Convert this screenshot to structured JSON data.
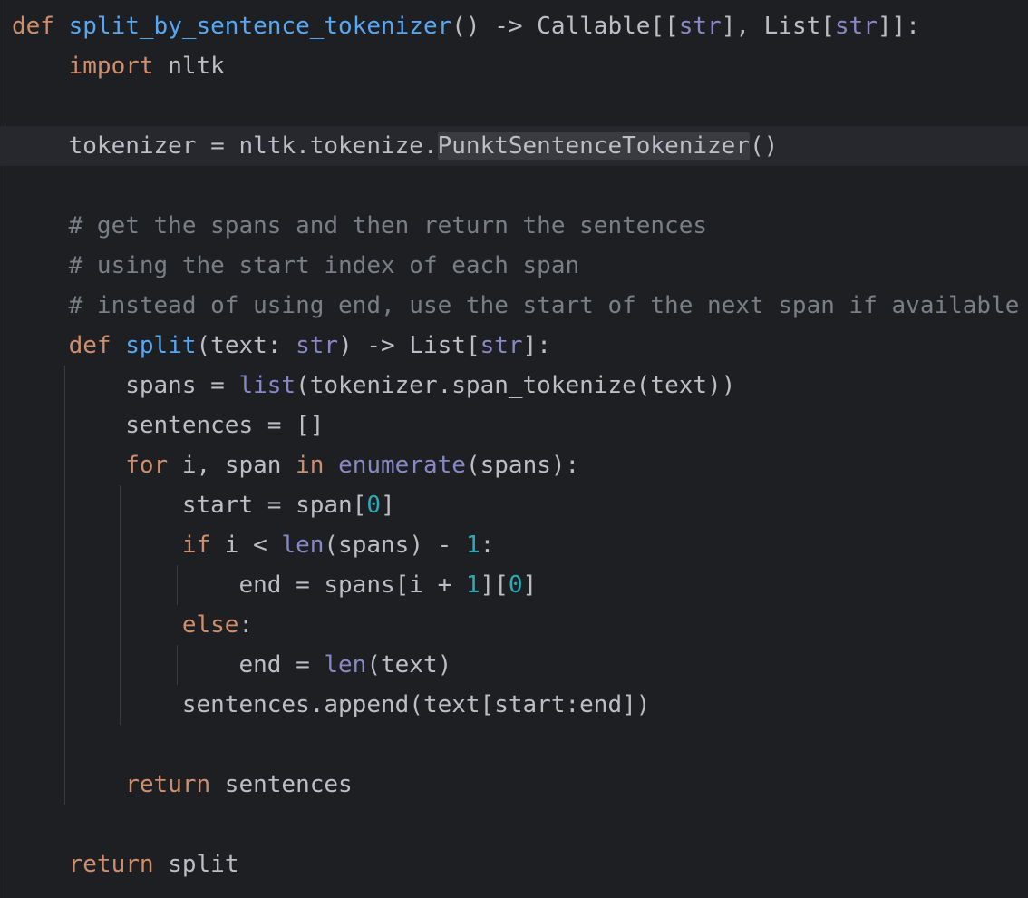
{
  "editor": {
    "language": "python",
    "colors": {
      "background": "#1e1f22",
      "current_line": "#26282e",
      "text": "#bcbec4",
      "keyword": "#cf8e6d",
      "function": "#56a8f5",
      "builtin": "#8888c6",
      "number": "#2aacb8",
      "comment": "#7a7e85",
      "highlight": "#393b40",
      "indent_guide": "#393b40"
    },
    "lines": [
      {
        "tokens": [
          {
            "text": "def",
            "type": "kw"
          },
          {
            "text": " ",
            "type": "plain"
          },
          {
            "text": "split_by_sentence_tokenizer",
            "type": "fn"
          },
          {
            "text": "() -> Callable[[",
            "type": "plain"
          },
          {
            "text": "str",
            "type": "builtin"
          },
          {
            "text": "], List[",
            "type": "plain"
          },
          {
            "text": "str",
            "type": "builtin"
          },
          {
            "text": "]]:",
            "type": "plain"
          }
        ]
      },
      {
        "tokens": [
          {
            "text": "    ",
            "type": "plain"
          },
          {
            "text": "import",
            "type": "kw"
          },
          {
            "text": " nltk",
            "type": "plain"
          }
        ]
      },
      {
        "tokens": []
      },
      {
        "current": true,
        "tokens": [
          {
            "text": "    tokenizer = nltk.tokenize.",
            "type": "plain"
          },
          {
            "text": "PunktSentenceTokenizer",
            "type": "hl"
          },
          {
            "text": "()",
            "type": "plain"
          }
        ]
      },
      {
        "tokens": []
      },
      {
        "tokens": [
          {
            "text": "    # get the spans and then return the sentences",
            "type": "cmt"
          }
        ]
      },
      {
        "tokens": [
          {
            "text": "    # using the start index of each span",
            "type": "cmt"
          }
        ]
      },
      {
        "tokens": [
          {
            "text": "    # instead of using end, use the start of the next span if available",
            "type": "cmt"
          }
        ]
      },
      {
        "tokens": [
          {
            "text": "    ",
            "type": "plain"
          },
          {
            "text": "def",
            "type": "kw"
          },
          {
            "text": " ",
            "type": "plain"
          },
          {
            "text": "split",
            "type": "fn"
          },
          {
            "text": "(text: ",
            "type": "plain"
          },
          {
            "text": "str",
            "type": "builtin"
          },
          {
            "text": ") -> List[",
            "type": "plain"
          },
          {
            "text": "str",
            "type": "builtin"
          },
          {
            "text": "]:",
            "type": "plain"
          }
        ]
      },
      {
        "tokens": [
          {
            "text": "        spans = ",
            "type": "plain"
          },
          {
            "text": "list",
            "type": "builtin"
          },
          {
            "text": "(tokenizer.span_tokenize(text))",
            "type": "plain"
          }
        ]
      },
      {
        "tokens": [
          {
            "text": "        sentences = []",
            "type": "plain"
          }
        ]
      },
      {
        "tokens": [
          {
            "text": "        ",
            "type": "plain"
          },
          {
            "text": "for",
            "type": "kw"
          },
          {
            "text": " i, span ",
            "type": "plain"
          },
          {
            "text": "in",
            "type": "kw"
          },
          {
            "text": " ",
            "type": "plain"
          },
          {
            "text": "enumerate",
            "type": "builtin"
          },
          {
            "text": "(spans):",
            "type": "plain"
          }
        ]
      },
      {
        "tokens": [
          {
            "text": "            start = span[",
            "type": "plain"
          },
          {
            "text": "0",
            "type": "num"
          },
          {
            "text": "]",
            "type": "plain"
          }
        ]
      },
      {
        "tokens": [
          {
            "text": "            ",
            "type": "plain"
          },
          {
            "text": "if",
            "type": "kw"
          },
          {
            "text": " i < ",
            "type": "plain"
          },
          {
            "text": "len",
            "type": "builtin"
          },
          {
            "text": "(spans) - ",
            "type": "plain"
          },
          {
            "text": "1",
            "type": "num"
          },
          {
            "text": ":",
            "type": "plain"
          }
        ]
      },
      {
        "tokens": [
          {
            "text": "                end = spans[i + ",
            "type": "plain"
          },
          {
            "text": "1",
            "type": "num"
          },
          {
            "text": "][",
            "type": "plain"
          },
          {
            "text": "0",
            "type": "num"
          },
          {
            "text": "]",
            "type": "plain"
          }
        ]
      },
      {
        "tokens": [
          {
            "text": "            ",
            "type": "plain"
          },
          {
            "text": "else",
            "type": "kw"
          },
          {
            "text": ":",
            "type": "plain"
          }
        ]
      },
      {
        "tokens": [
          {
            "text": "                end = ",
            "type": "plain"
          },
          {
            "text": "len",
            "type": "builtin"
          },
          {
            "text": "(text)",
            "type": "plain"
          }
        ]
      },
      {
        "tokens": [
          {
            "text": "            sentences.append(text[start:end])",
            "type": "plain"
          }
        ]
      },
      {
        "tokens": []
      },
      {
        "tokens": [
          {
            "text": "        ",
            "type": "plain"
          },
          {
            "text": "return",
            "type": "kw"
          },
          {
            "text": " sentences",
            "type": "plain"
          }
        ]
      },
      {
        "tokens": []
      },
      {
        "tokens": [
          {
            "text": "    ",
            "type": "plain"
          },
          {
            "text": "return",
            "type": "kw"
          },
          {
            "text": " split",
            "type": "plain"
          }
        ]
      }
    ]
  }
}
